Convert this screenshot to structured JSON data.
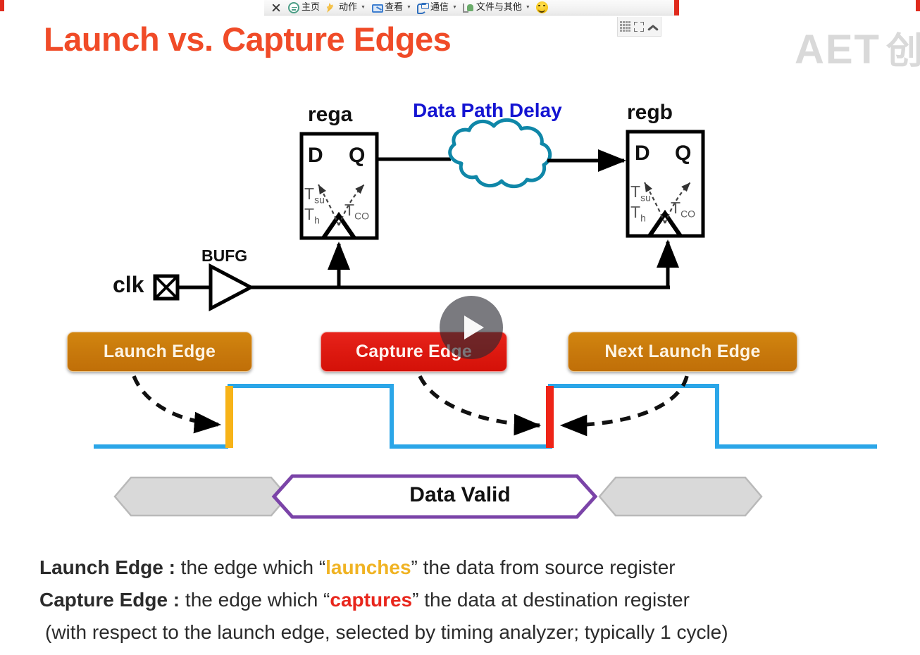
{
  "toolbar": {
    "close_label": "",
    "items": [
      {
        "label": "主页",
        "icon": "home-icon",
        "caret": false
      },
      {
        "label": "动作",
        "icon": "bolt-icon",
        "caret": true
      },
      {
        "label": "查看",
        "icon": "view-icon",
        "caret": true
      },
      {
        "label": "通信",
        "icon": "phone-icon",
        "caret": true
      },
      {
        "label": "文件与其他",
        "icon": "file-icon",
        "caret": true
      }
    ],
    "smiley": "smiley-icon"
  },
  "minibar": {
    "grid": "grid-icon",
    "expand": "fullscreen-icon",
    "collapse": "chevron-up-icon"
  },
  "slide": {
    "title": "Launch vs. Capture Edges",
    "watermark": "AET",
    "watermark_cn": "创",
    "data_path_delay": "Data Path Delay",
    "clk": "clk",
    "bufg": "BUFG",
    "data_valid": "Data Valid",
    "registers": [
      {
        "name": "rega",
        "d": "D",
        "q": "Q",
        "tsu": "T",
        "tsu_sub": "su",
        "th": "T",
        "th_sub": "h",
        "tco": "T",
        "tco_sub": "CO"
      },
      {
        "name": "regb",
        "d": "D",
        "q": "Q",
        "tsu": "T",
        "tsu_sub": "su",
        "th": "T",
        "th_sub": "h",
        "tco": "T",
        "tco_sub": "CO"
      }
    ],
    "edges": [
      {
        "label": "Launch Edge",
        "style": "orange"
      },
      {
        "label": "Capture  Edge",
        "style": "red"
      },
      {
        "label": "Next Launch Edge",
        "style": "orange"
      }
    ],
    "legend": {
      "l1_bold": "Launch Edge :",
      "l1_a": " the edge which “",
      "l1_hl": "launches",
      "l1_b": "” the data from source register",
      "l2_bold": "Capture Edge :",
      "l2_a": " the edge which “",
      "l2_hl": "captures",
      "l2_b": "” the data at destination register",
      "l3": "(with respect to the launch edge, selected by timing analyzer; typically 1 cycle)"
    }
  },
  "colors": {
    "title": "#f04b28",
    "data_path_delay": "#1414d2",
    "cloud": "#0f87a8",
    "waveform": "#2ba6e8",
    "launch_marker": "#f7b318",
    "capture_marker": "#ee2417",
    "data_valid_outline": "#7b44a8",
    "pill_orange": "#c8790c",
    "pill_red": "#dd1910",
    "highlight_launch": "#f0b323",
    "highlight_capture": "#e8261c"
  },
  "play_button": "play-icon"
}
